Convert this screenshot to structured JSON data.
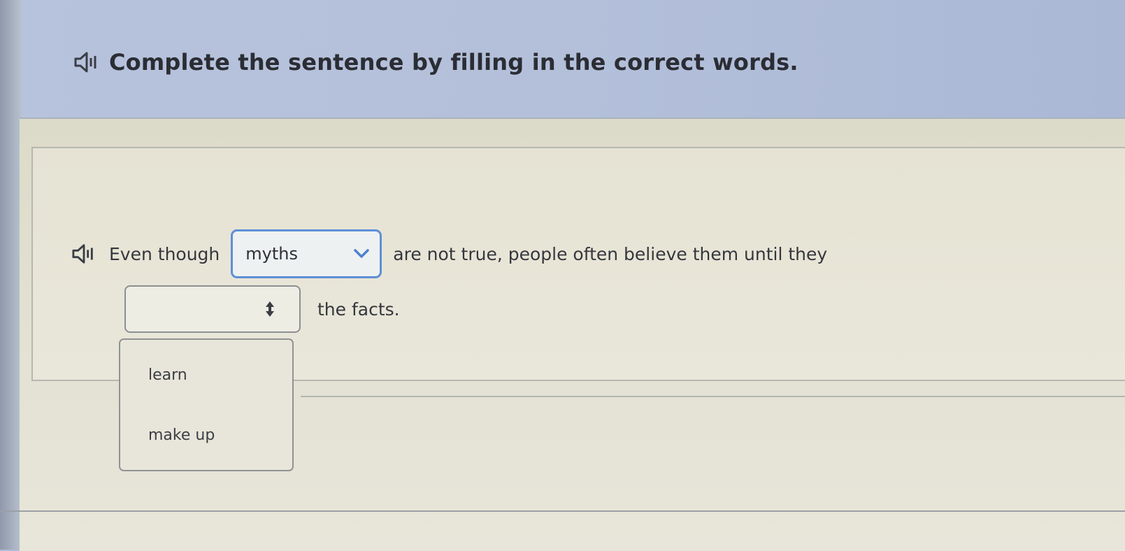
{
  "instruction": {
    "text": "Complete the sentence by filling in the correct words.",
    "icon": "speaker-icon"
  },
  "sentence": {
    "icon": "speaker-icon",
    "part1": "Even though",
    "dropdown1": {
      "selected": "myths",
      "icon": "chevron-down-icon"
    },
    "part2": "are not true, people often believe them until they",
    "dropdown2": {
      "selected": "",
      "icon": "up-down-arrow-icon",
      "options": [
        "learn",
        "make up"
      ]
    },
    "part3": "the facts."
  },
  "colors": {
    "accent": "#5e8fd6",
    "header_bg": "#b7c3dc",
    "panel_bg": "#e6e3d4"
  }
}
